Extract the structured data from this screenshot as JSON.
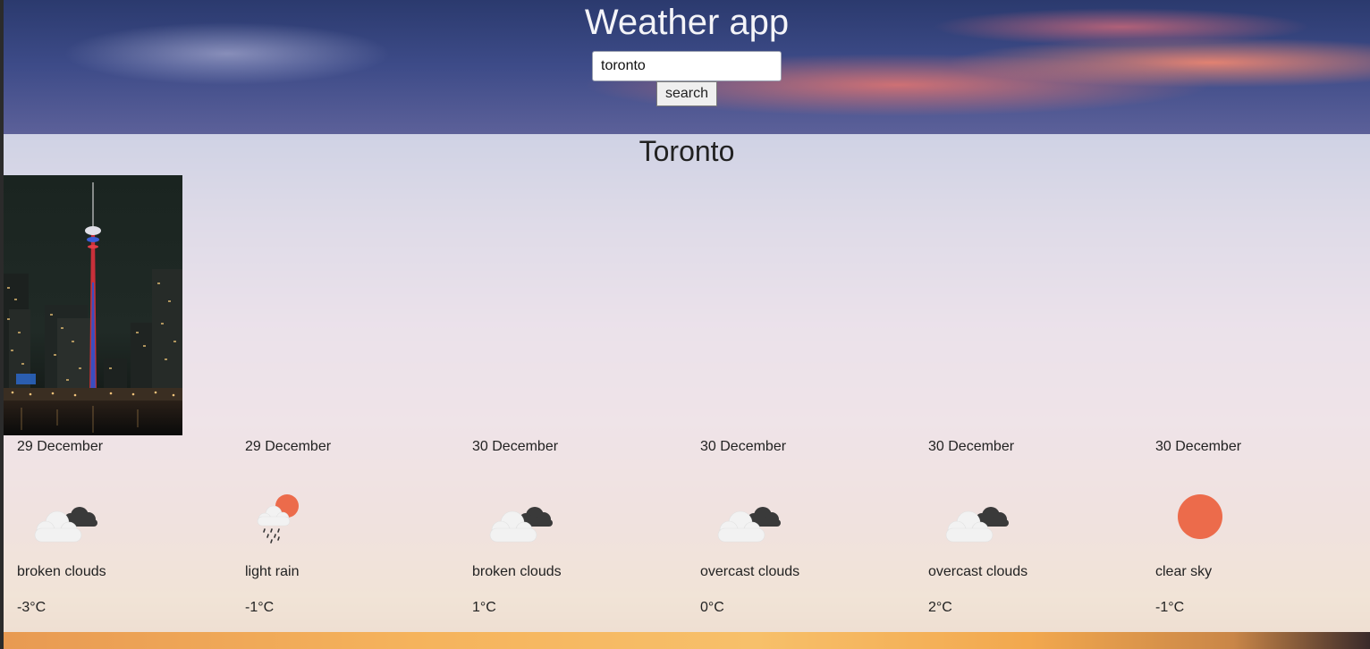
{
  "header": {
    "title": "Weather app",
    "search_value": "toronto",
    "search_button_label": "search"
  },
  "city": {
    "name": "Toronto",
    "photo_icon": "cn-tower-night-photo"
  },
  "colors": {
    "sun": "#ec6b4b",
    "cloud_light": "#f2f2f2",
    "cloud_dark": "#3a3a3a",
    "text": "#222222"
  },
  "forecast": [
    {
      "date": "29 December",
      "icon": "broken-clouds-icon",
      "description": "broken clouds",
      "temp": "-3°C"
    },
    {
      "date": "29 December",
      "icon": "light-rain-icon",
      "description": "light rain",
      "temp": "-1°C"
    },
    {
      "date": "30 December",
      "icon": "broken-clouds-icon",
      "description": "broken clouds",
      "temp": "1°C"
    },
    {
      "date": "30 December",
      "icon": "overcast-clouds-icon",
      "description": "overcast clouds",
      "temp": "0°C"
    },
    {
      "date": "30 December",
      "icon": "overcast-clouds-icon",
      "description": "overcast clouds",
      "temp": "2°C"
    },
    {
      "date": "30 December",
      "icon": "clear-sky-icon",
      "description": "clear sky",
      "temp": "-1°C"
    }
  ]
}
